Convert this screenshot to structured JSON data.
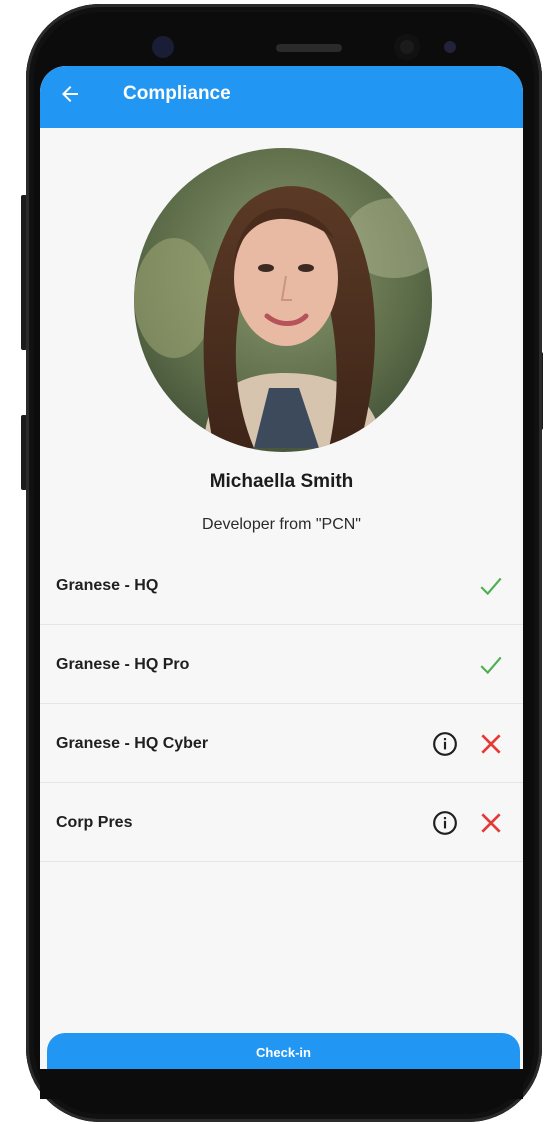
{
  "appbar": {
    "title": "Compliance",
    "back_icon": "arrow-left-icon"
  },
  "profile": {
    "name": "Michaella Smith",
    "role": "Developer from \"PCN\""
  },
  "compliance_items": [
    {
      "label": "Granese - HQ",
      "status": "compliant",
      "status_icon": "check-icon",
      "has_info": false
    },
    {
      "label": "Granese - HQ Pro",
      "status": "compliant",
      "status_icon": "check-icon",
      "has_info": false
    },
    {
      "label": "Granese - HQ Cyber",
      "status": "non-compliant",
      "status_icon": "close-icon",
      "has_info": true
    },
    {
      "label": "Corp Pres",
      "status": "non-compliant",
      "status_icon": "close-icon",
      "has_info": true
    }
  ],
  "actions": {
    "checkin_label": "Check-in"
  },
  "colors": {
    "primary": "#2196f3",
    "success": "#4caf50",
    "error": "#e53935",
    "background": "#f7f7f7"
  }
}
